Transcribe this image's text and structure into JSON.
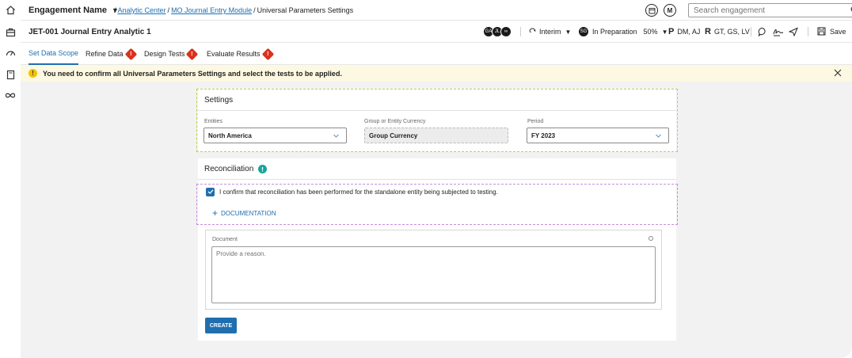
{
  "colors": {
    "accent": "#1f6fb0",
    "warning": "#d9331c",
    "banner_bg": "#fdf8e1",
    "teal": "#1aa39a"
  },
  "rail": {
    "icons": [
      "home-icon",
      "briefcase-icon",
      "gauge-icon",
      "book-icon",
      "infinity-icon"
    ]
  },
  "topbar": {
    "engagement_name": "Engagement Name",
    "breadcrumb_sep1": "/",
    "breadcrumb_1": "Analytic Center",
    "breadcrumb_sep2": "/",
    "breadcrumb_2": "MO Journal Entry Module",
    "breadcrumb_sep3": "/",
    "breadcrumb_3": "Universal Parameters Settings",
    "user_initial": "M",
    "search_placeholder": "Search engagement"
  },
  "titlebar": {
    "title": "JET-001 Journal Entry Analytic 1",
    "avatars": [
      "GA",
      "JL",
      "∞"
    ],
    "interim_label": "Interim",
    "status_initials": "SG",
    "status_label": "In Preparation",
    "percent_label": "50%",
    "p_label": "P",
    "p_value": "DM, AJ",
    "r_label": "R",
    "r_value": "GT, GS, LV",
    "save_label": "Save"
  },
  "tabs": [
    {
      "label": "Set Data Scope",
      "active": true,
      "warning": false
    },
    {
      "label": "Refine Data",
      "active": false,
      "warning": true
    },
    {
      "label": "Design Tests",
      "active": false,
      "warning": true
    },
    {
      "label": "Evaluate Results",
      "active": false,
      "warning": true
    }
  ],
  "banner": {
    "message": "You need to confirm all Universal Parameters Settings and select the tests to be applied."
  },
  "settings": {
    "heading": "Settings",
    "entities_label": "Entities",
    "entities_value": "North America",
    "currency_label": "Group or Entity Currency",
    "currency_value": "Group Currency",
    "period_label": "Period",
    "period_value": "FY 2023"
  },
  "reconciliation": {
    "heading": "Reconciliation",
    "confirm_text": "I confirm that reconciliation has been performed for the standalone entity being subjected to testing.",
    "confirm_checked": true,
    "documentation_label": "DOCUMENTATION",
    "document_label": "Document",
    "document_placeholder": "Provide a reason.",
    "create_label": "CREATE"
  }
}
